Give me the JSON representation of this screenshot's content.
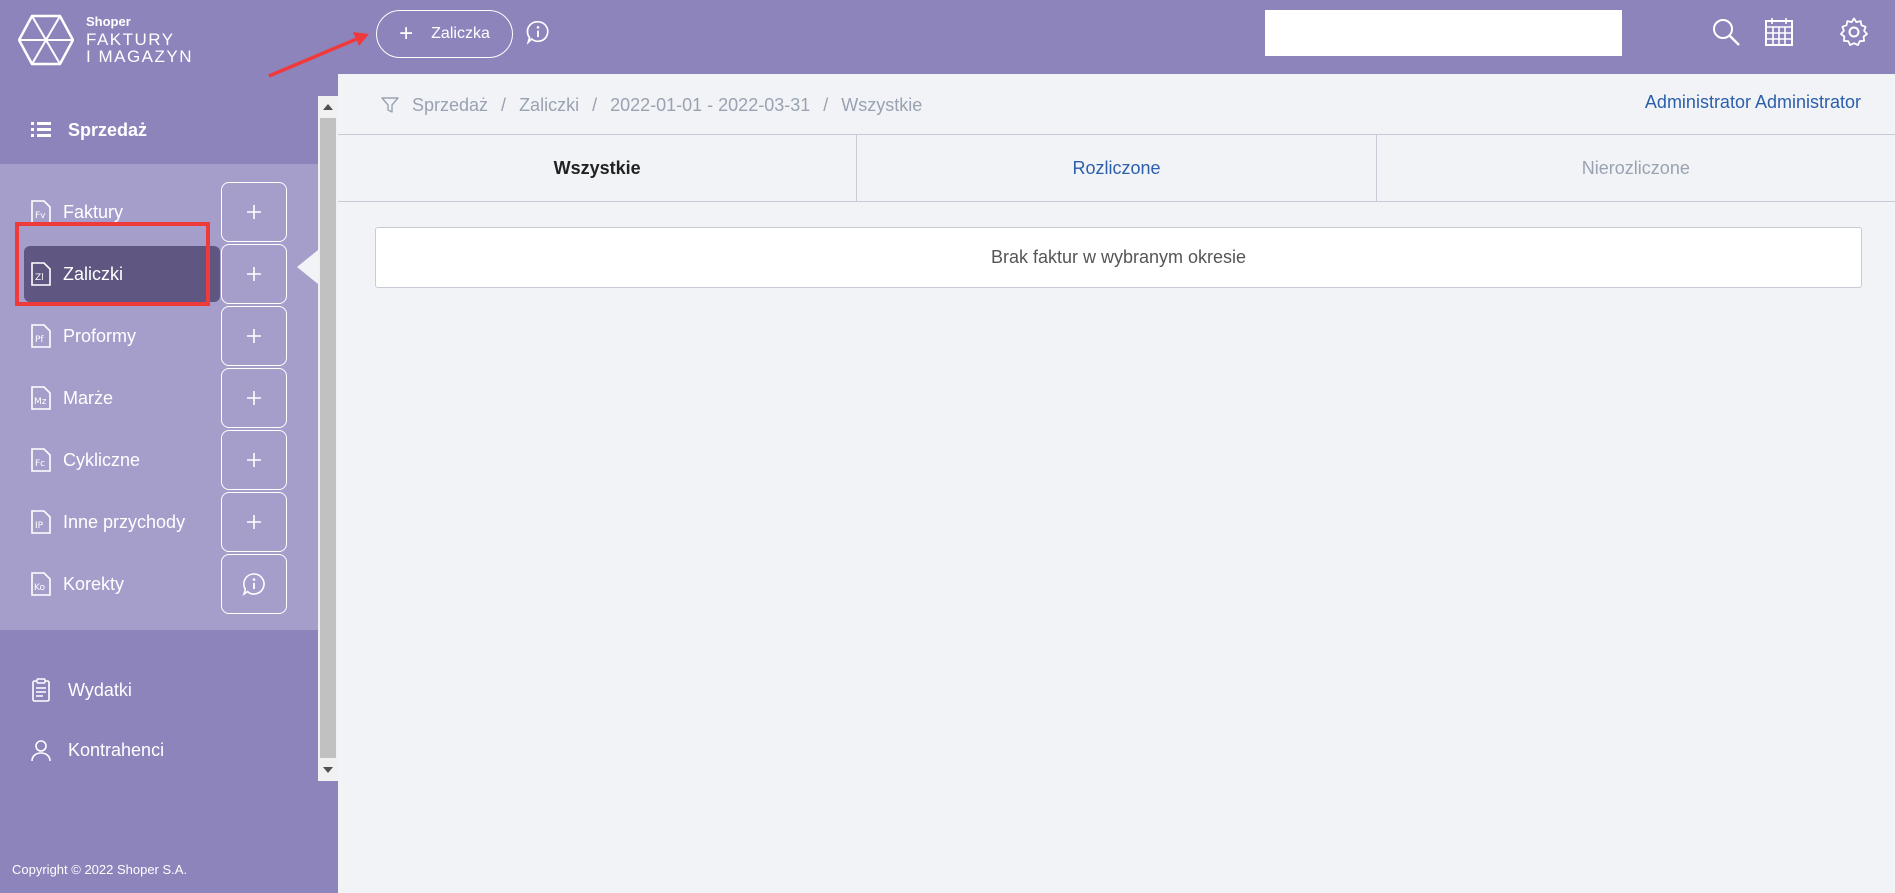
{
  "logo": {
    "brand_small": "Shoper",
    "brand_line1": "FAKTURY",
    "brand_line2": "I MAGAZYN"
  },
  "sidebar": {
    "section_title": "Sprzedaż",
    "sub_items": [
      {
        "label": "Faktury",
        "icon": "document-fv-icon",
        "action": "plus"
      },
      {
        "label": "Zaliczki",
        "icon": "document-zl-icon",
        "action": "plus",
        "active": true
      },
      {
        "label": "Proformy",
        "icon": "document-pf-icon",
        "action": "plus"
      },
      {
        "label": "Marże",
        "icon": "document-mz-icon",
        "action": "plus"
      },
      {
        "label": "Cykliczne",
        "icon": "document-fc-icon",
        "action": "plus"
      },
      {
        "label": "Inne przychody",
        "icon": "document-ip-icon",
        "action": "plus"
      },
      {
        "label": "Korekty",
        "icon": "document-ko-icon",
        "action": "info"
      }
    ],
    "main_items": [
      {
        "label": "Wydatki",
        "icon": "clipboard-icon"
      },
      {
        "label": "Kontrahenci",
        "icon": "user-icon"
      }
    ],
    "copyright": "Copyright © 2022 Shoper S.A."
  },
  "topbar": {
    "add_button_label": "Zaliczka",
    "search_placeholder": ""
  },
  "breadcrumb": {
    "items": [
      "Sprzedaż",
      "Zaliczki",
      "2022-01-01 - 2022-03-31",
      "Wszystkie"
    ],
    "separator": "/"
  },
  "user": {
    "name": "Administrator Administrator"
  },
  "tabs": [
    {
      "label": "Wszystkie",
      "state": "active"
    },
    {
      "label": "Rozliczone",
      "state": "link"
    },
    {
      "label": "Nierozliczone",
      "state": "muted"
    }
  ],
  "empty_message": "Brak faktur w wybranym okresie",
  "colors": {
    "primary": "#8d84bc",
    "sub_panel": "#a59ecb",
    "active_item": "#5f5781",
    "highlight": "#f0393b",
    "link": "#2b5fab"
  }
}
